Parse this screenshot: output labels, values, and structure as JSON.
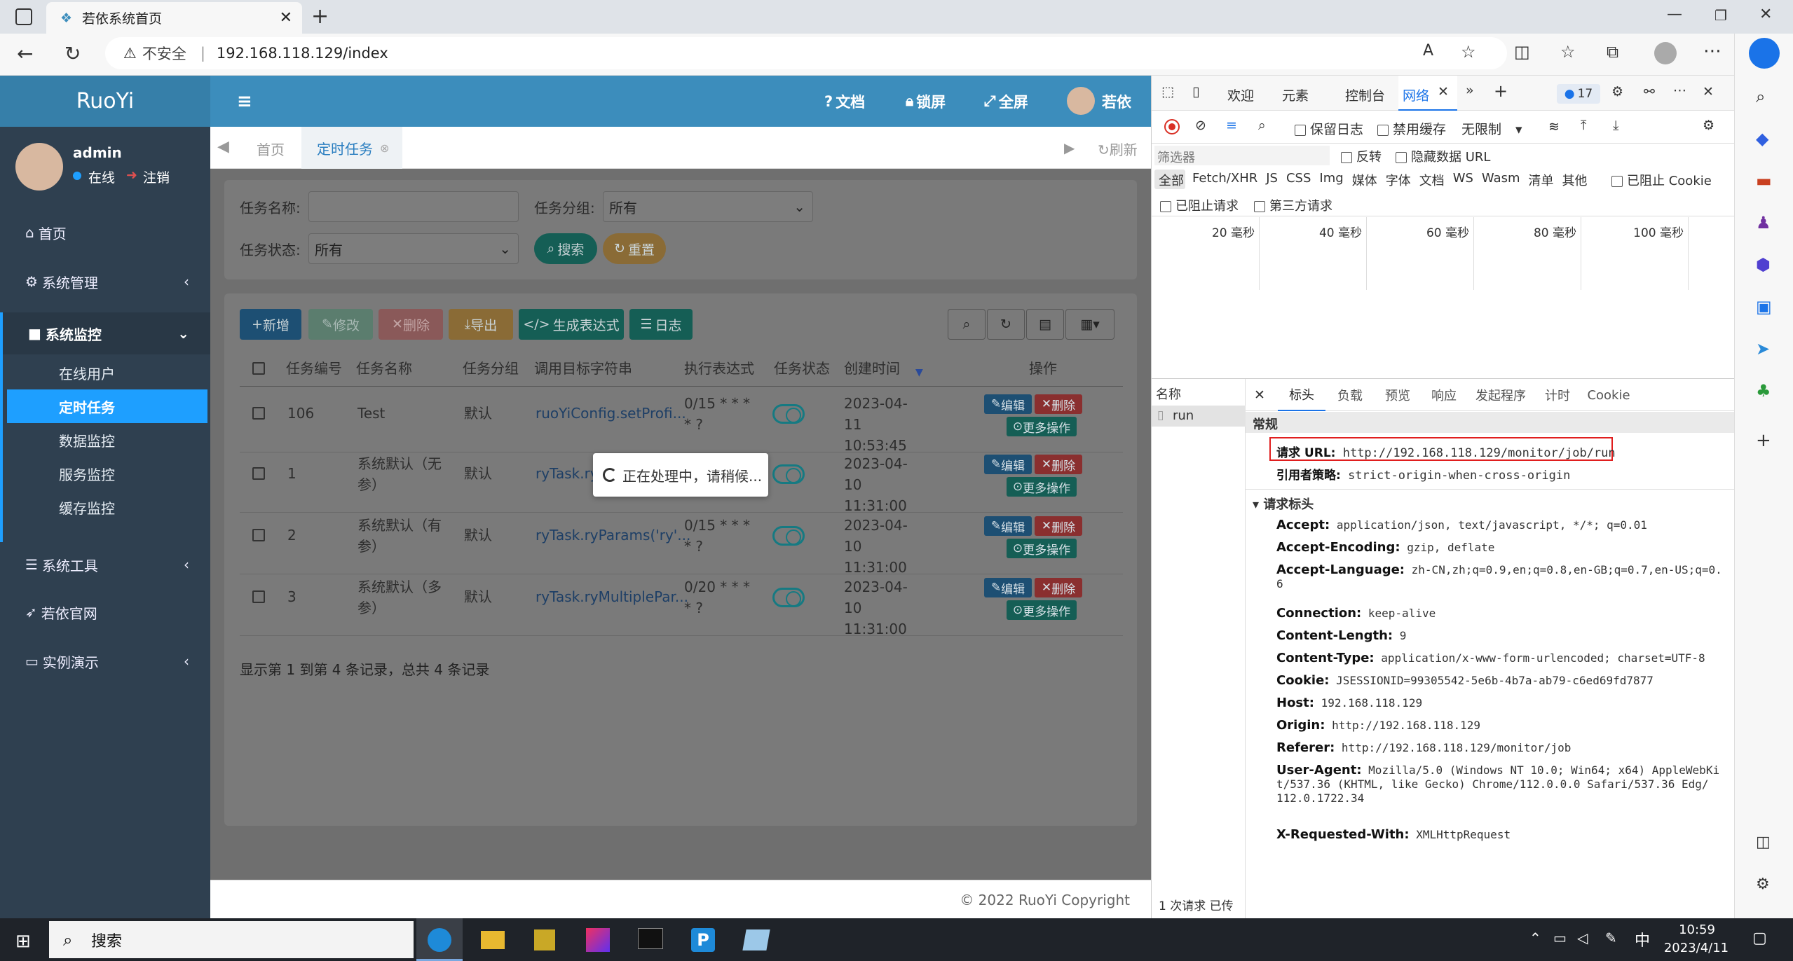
{
  "browser": {
    "tab_title": "若依系统首页",
    "url": "192.168.118.129/index",
    "security": "不安全"
  },
  "app": {
    "logo": "RuoYi",
    "user": {
      "name": "admin",
      "status": "在线",
      "logout": "注销"
    },
    "menu": [
      {
        "label": "首页"
      },
      {
        "label": "系统管理"
      },
      {
        "label": "系统监控"
      },
      {
        "label": "系统工具"
      },
      {
        "label": "若依官网"
      },
      {
        "label": "实例演示"
      }
    ],
    "submenu": [
      {
        "label": "在线用户"
      },
      {
        "label": "定时任务"
      },
      {
        "label": "数据监控"
      },
      {
        "label": "服务监控"
      },
      {
        "label": "缓存监控"
      }
    ],
    "topnav": {
      "docs": "文档",
      "lock": "锁屏",
      "fullscreen": "全屏",
      "username": "若依"
    },
    "tabs": {
      "home": "首页",
      "active": "定时任务",
      "refresh": "刷新"
    },
    "search": {
      "name_label": "任务名称:",
      "group_label": "任务分组:",
      "group_value": "所有",
      "status_label": "任务状态:",
      "status_value": "所有",
      "search_btn": "搜索",
      "reset_btn": "重置"
    },
    "toolbar": {
      "add": "新增",
      "edit": "修改",
      "delete": "删除",
      "export": "导出",
      "cron": "生成表达式",
      "log": "日志"
    },
    "table": {
      "headers": [
        "任务编号",
        "任务名称",
        "任务分组",
        "调用目标字符串",
        "执行表达式",
        "任务状态",
        "创建时间",
        "操作"
      ],
      "rows": [
        {
          "id": "106",
          "name": "Test",
          "group": "默认",
          "target": "ruoYiConfig.setProfi...",
          "cron": "0/15 * * * * ?",
          "created": "2023-04-11 10:53:45"
        },
        {
          "id": "1",
          "name": "系统默认（无参）",
          "group": "默认",
          "target": "ryTask.ry",
          "cron": "",
          "created": "2023-04-10 11:31:00"
        },
        {
          "id": "2",
          "name": "系统默认（有参）",
          "group": "默认",
          "target": "ryTask.ryParams('ry'...",
          "cron": "0/15 * * * * ?",
          "created": "2023-04-10 11:31:00"
        },
        {
          "id": "3",
          "name": "系统默认（多参）",
          "group": "默认",
          "target": "ryTask.ryMultiplePar...",
          "cron": "0/20 * * * * ?",
          "created": "2023-04-10 11:31:00"
        }
      ],
      "row_edit": "编辑",
      "row_delete": "删除",
      "row_more": "更多操作",
      "pagination": "显示第 1 到第 4 条记录，总共 4 条记录"
    },
    "loading": "正在处理中，请稍候...",
    "footer": "© 2022 RuoYi Copyright"
  },
  "devtools": {
    "tabs": [
      "欢迎",
      "元素",
      "控制台",
      "网络"
    ],
    "badge": "17",
    "toolbar": {
      "preserve_log": "保留日志",
      "disable_cache": "禁用缓存",
      "throttle": "无限制"
    },
    "filter": {
      "placeholder": "筛选器",
      "invert": "反转",
      "hide_data": "隐藏数据 URL"
    },
    "types": [
      "全部",
      "Fetch/XHR",
      "JS",
      "CSS",
      "Img",
      "媒体",
      "字体",
      "文档",
      "WS",
      "Wasm",
      "清单",
      "其他"
    ],
    "blocked_cookies": "已阻止 Cookie",
    "blocked_requests": "已阻止请求",
    "third_party": "第三方请求",
    "timeline": [
      "20 毫秒",
      "40 毫秒",
      "60 毫秒",
      "80 毫秒",
      "100 毫秒"
    ],
    "name_col": "名称",
    "request_name": "run",
    "detail_tabs": [
      "标头",
      "负载",
      "预览",
      "响应",
      "发起程序",
      "计时",
      "Cookie"
    ],
    "general_title": "常规",
    "request_url_key": "请求 URL:",
    "request_url": "http://192.168.118.129/monitor/job/run",
    "referrer_key": "引用者策略:",
    "referrer": "strict-origin-when-cross-origin",
    "req_headers_title": "请求标头",
    "headers": [
      {
        "k": "Accept:",
        "v": "application/json, text/javascript, */*; q=0.01"
      },
      {
        "k": "Accept-Encoding:",
        "v": "gzip, deflate"
      },
      {
        "k": "Accept-Language:",
        "v": "zh-CN,zh;q=0.9,en;q=0.8,en-GB;q=0.7,en-US;q=0.",
        "v2": "6"
      },
      {
        "k": "Connection:",
        "v": "keep-alive"
      },
      {
        "k": "Content-Length:",
        "v": "9"
      },
      {
        "k": "Content-Type:",
        "v": "application/x-www-form-urlencoded; charset=UTF-8"
      },
      {
        "k": "Cookie:",
        "v": "JSESSIONID=99305542-5e6b-4b7a-ab79-c6ed69fd7877"
      },
      {
        "k": "Host:",
        "v": "192.168.118.129"
      },
      {
        "k": "Origin:",
        "v": "http://192.168.118.129"
      },
      {
        "k": "Referer:",
        "v": "http://192.168.118.129/monitor/job"
      },
      {
        "k": "User-Agent:",
        "v": "Mozilla/5.0 (Windows NT 10.0; Win64; x64) AppleWebKi",
        "v2": "t/537.36 (KHTML, like Gecko) Chrome/112.0.0.0 Safari/537.36 Edg/",
        "v3": "112.0.1722.34"
      },
      {
        "k": "X-Requested-With:",
        "v": "XMLHttpRequest"
      }
    ],
    "status": "1 次请求  已传"
  },
  "taskbar": {
    "search": "搜索",
    "time": "10:59",
    "date": "2023/4/11",
    "ime": "中"
  },
  "colors": {
    "sidebar": "#2f4050",
    "header": "#3c8dbc",
    "accent": "#1e9fff",
    "highlight": "#e01e1e"
  }
}
